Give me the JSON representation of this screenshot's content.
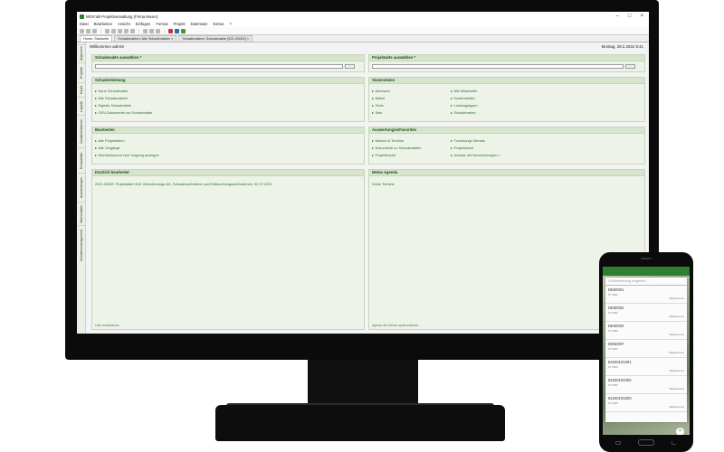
{
  "window": {
    "title": "MOS'aik Projektverwaltung (Firma Muser)",
    "min": "–",
    "max": "□",
    "close": "×"
  },
  "menu": [
    "Datei",
    "Bearbeiten",
    "Ansicht",
    "Einfügen",
    "Format",
    "Projekt",
    "Datensatz",
    "Extras",
    "?"
  ],
  "tabs": [
    "Home: Startseite",
    "Schadenakten: Alle Schadenakten ×",
    "Schadenakten: Schadenakte [S21-00002] ×"
  ],
  "sidebar": [
    "Allgemein",
    "Projekte",
    "Kaufe",
    "Logistik",
    "Zusatzfunktionen",
    "Einkaufliste",
    "Auswertungen",
    "Stammdaten",
    "Schadenmanagement"
  ],
  "header": {
    "welcome": "Willkommen admin!",
    "date": "Montag, 28.2.2022  8:41"
  },
  "panels": {
    "schadenakte": {
      "title": "Schadenakte auswählen *",
      "button": "..."
    },
    "projektakte": {
      "title": "Projektakte auswählen *",
      "button": "..."
    },
    "schadensteuerung": {
      "title": "Schadenleistung",
      "links": [
        "Neue Schadenakte",
        "Alle Schadenakten",
        "Digitale Schadenakte",
        "GDV-Dokumente zur Schadenakte"
      ]
    },
    "stammdaten": {
      "title": "Stammdaten",
      "col1": [
        "Adressen",
        "Artikel",
        "Texte",
        "Sets"
      ],
      "col2": [
        "Alle Mitarbeiter",
        "Kostenstellen",
        "Leistungstypen",
        "Schadenarten"
      ]
    },
    "bearbeiten": {
      "title": "Bearbeiten",
      "links": [
        "Alle Projektakten",
        "Alle Vorgänge",
        "Worddokument zum Vorgang anzeigen"
      ]
    },
    "auswertungen": {
      "title": "Auswertungen/Favoriten",
      "col1": [
        "Notizen & Termine",
        "Dokumente zu Schadenakten",
        "Projektbuche"
      ],
      "col2": [
        "Trocknungs Dienste",
        "Projektstand",
        "Umsatz mit Versicherungen »"
      ]
    },
    "kuerzlich": {
      "title": "Kürzlich bearbeitet",
      "item": "2021.00002: Projektakte HUK Versicherungs AG, Schadenaufnahme und Entfeuchtungsmaßnahmen, 02.07.2021",
      "footer": "Liste zurücksetzen..."
    },
    "agenda": {
      "title": "Meine Agenda",
      "item": "Keine Termine",
      "footer": "Agenda mit Outlook synchronisieren..."
    }
  },
  "phone": {
    "search_placeholder": "Geräteleimung eingeben...",
    "rows": [
      {
        "id": "DE50001",
        "sub": "KT 0000",
        "status": "Wartetermine"
      },
      {
        "id": "DE50002",
        "sub": "KT 0000",
        "status": "Wartetermine"
      },
      {
        "id": "DE50004",
        "sub": "KT 0000",
        "status": "Wartetermine"
      },
      {
        "id": "DE50007",
        "sub": "KT 0000",
        "status": "Wartetermine"
      },
      {
        "id": "62200101001",
        "sub": "KT 0000",
        "status": "Wartetermine"
      },
      {
        "id": "62200101002",
        "sub": "KT 0000",
        "status": "Wartetermine"
      },
      {
        "id": "62200101003",
        "sub": "KT 0000",
        "status": "Wartetermine"
      }
    ],
    "close": "×"
  },
  "colors": {
    "accent": "#2d6b2d",
    "panel_bg": "#edf3e8",
    "panel_head": "#d6e5cc"
  }
}
